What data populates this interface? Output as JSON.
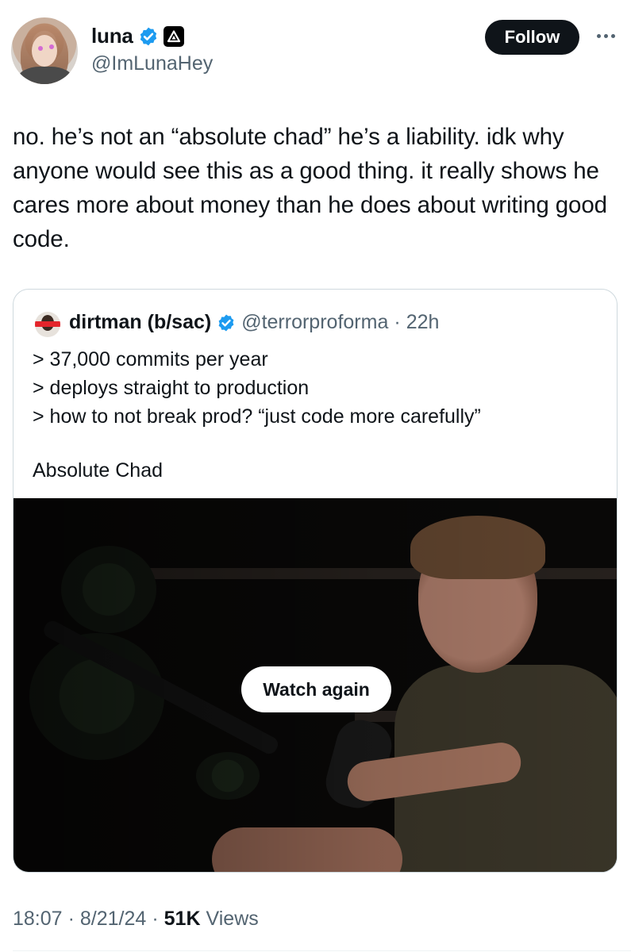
{
  "author": {
    "display_name": "luna",
    "handle": "@ImLunaHey",
    "verified": true,
    "affiliation_badge_icon": "delta-icon"
  },
  "actions": {
    "follow_label": "Follow",
    "more_icon": "more-horizontal-icon"
  },
  "tweet": {
    "text": "no. he’s not an “absolute chad” he’s a liability. idk why anyone would see this as a good thing. it really shows he cares more about money than he does about writing good code."
  },
  "quote": {
    "display_name": "dirtman (b/sac)",
    "handle": "@terrorproforma",
    "separator": "·",
    "time": "22h",
    "verified": true,
    "lines": [
      "> 37,000 commits per year",
      "> deploys straight to production",
      "> how to not break prod? “just code more carefully”"
    ],
    "closing": "Absolute Chad",
    "media": {
      "type": "video",
      "button_label": "Watch again"
    }
  },
  "footer": {
    "time": "18:07",
    "sep1": "·",
    "date": "8/21/24",
    "sep2": "·",
    "views_count": "51K",
    "views_label": "Views"
  },
  "colors": {
    "text_primary": "#0f1419",
    "text_secondary": "#536471",
    "verified_blue": "#1d9bf0",
    "border": "#cfd9de"
  }
}
